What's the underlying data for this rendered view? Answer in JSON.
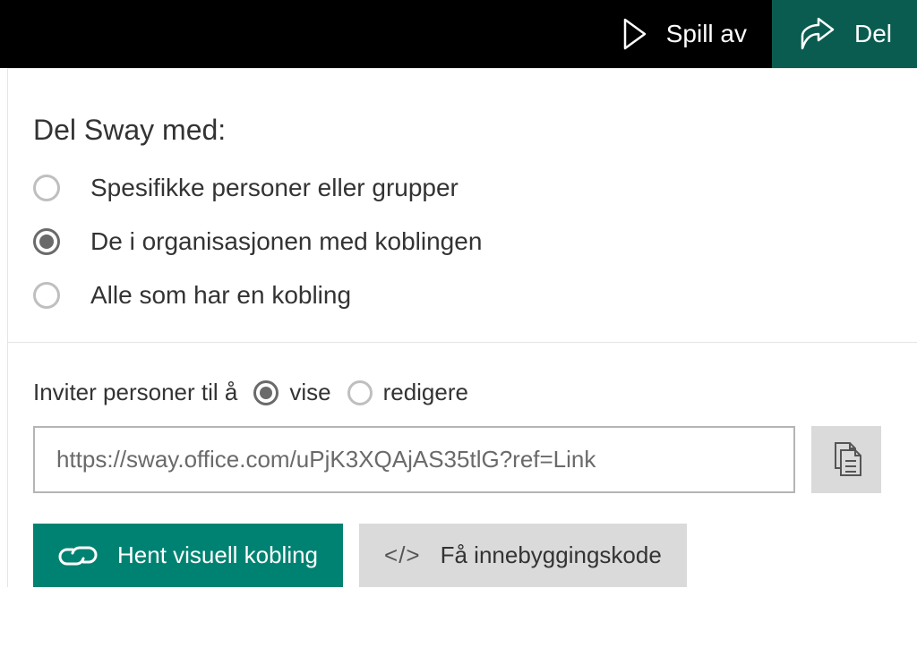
{
  "topbar": {
    "play_label": "Spill av",
    "share_label": "Del"
  },
  "share": {
    "title": "Del Sway med:",
    "options": {
      "specific": "Spesifikke personer eller grupper",
      "org": "De i organisasjonen med koblingen",
      "anyone": "Alle som har en kobling"
    },
    "invite_prefix": "Inviter personer til å",
    "perm_view": "vise",
    "perm_edit": "redigere",
    "link_value": "https://sway.office.com/uPjK3XQAjAS35tlG?ref=Link",
    "visual_link_label": "Hent visuell kobling",
    "embed_label": "Få innebyggingskode"
  }
}
